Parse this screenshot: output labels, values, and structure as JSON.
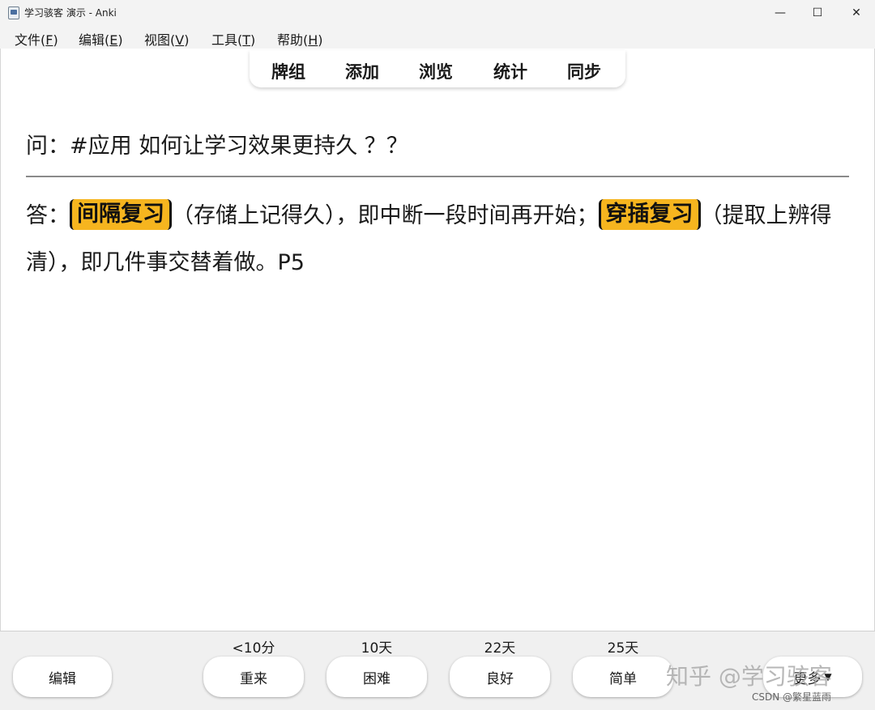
{
  "window": {
    "title": "学习骇客 演示 - Anki",
    "minimize_glyph": "—",
    "maximize_glyph": "☐",
    "close_glyph": "✕"
  },
  "menu": [
    {
      "label": "文件",
      "key": "F"
    },
    {
      "label": "编辑",
      "key": "E"
    },
    {
      "label": "视图",
      "key": "V"
    },
    {
      "label": "工具",
      "key": "T"
    },
    {
      "label": "帮助",
      "key": "H"
    }
  ],
  "toolbar": {
    "decks": "牌组",
    "add": "添加",
    "browse": "浏览",
    "stats": "统计",
    "sync": "同步"
  },
  "card": {
    "question": "问：#应用 如何让学习效果更持久 ？？",
    "answer_prefix": "答：",
    "highlight1": "间隔复习",
    "answer_mid1": "（存储上记得久），即中断一段时间再开始；",
    "highlight2": "穿插复习",
    "answer_mid2": "（提取上辨得清），即几件事交替着做。P5"
  },
  "bottom": {
    "edit": "编辑",
    "again_interval": "<10分",
    "again": "重来",
    "hard_interval": "10天",
    "hard": "困难",
    "good_interval": "22天",
    "good": "良好",
    "easy_interval": "25天",
    "easy": "简单",
    "more": "更多"
  },
  "watermark": {
    "zhihu": "知乎 @学习骇客",
    "csdn": "CSDN @繁星蓝雨"
  },
  "colors": {
    "highlight": "#f6b51f",
    "chrome": "#f3f3f3",
    "bottom_bar": "#f0f0f0"
  }
}
